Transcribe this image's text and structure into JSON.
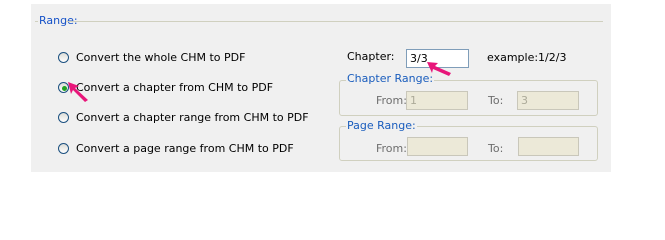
{
  "range_group": {
    "legend": "Range:"
  },
  "options": [
    {
      "label": "Convert the whole CHM to PDF",
      "checked": false
    },
    {
      "label": "Convert a chapter from CHM to PDF",
      "checked": true
    },
    {
      "label": "Convert a chapter range from CHM to PDF",
      "checked": false
    },
    {
      "label": "Convert a page range from CHM to PDF",
      "checked": false
    }
  ],
  "chapter": {
    "label": "Chapter:",
    "value": "3/3",
    "example": "example:1/2/3"
  },
  "chapter_range": {
    "legend": "Chapter Range:",
    "from_label": "From:",
    "from_value": "1",
    "to_label": "To:",
    "to_value": "3"
  },
  "page_range": {
    "legend": "Page Range:",
    "from_label": "From:",
    "from_value": "",
    "to_label": "To:",
    "to_value": ""
  },
  "colors": {
    "accent": "#1652c8",
    "pointer": "#e8167a",
    "radio_check": "#21a121"
  }
}
